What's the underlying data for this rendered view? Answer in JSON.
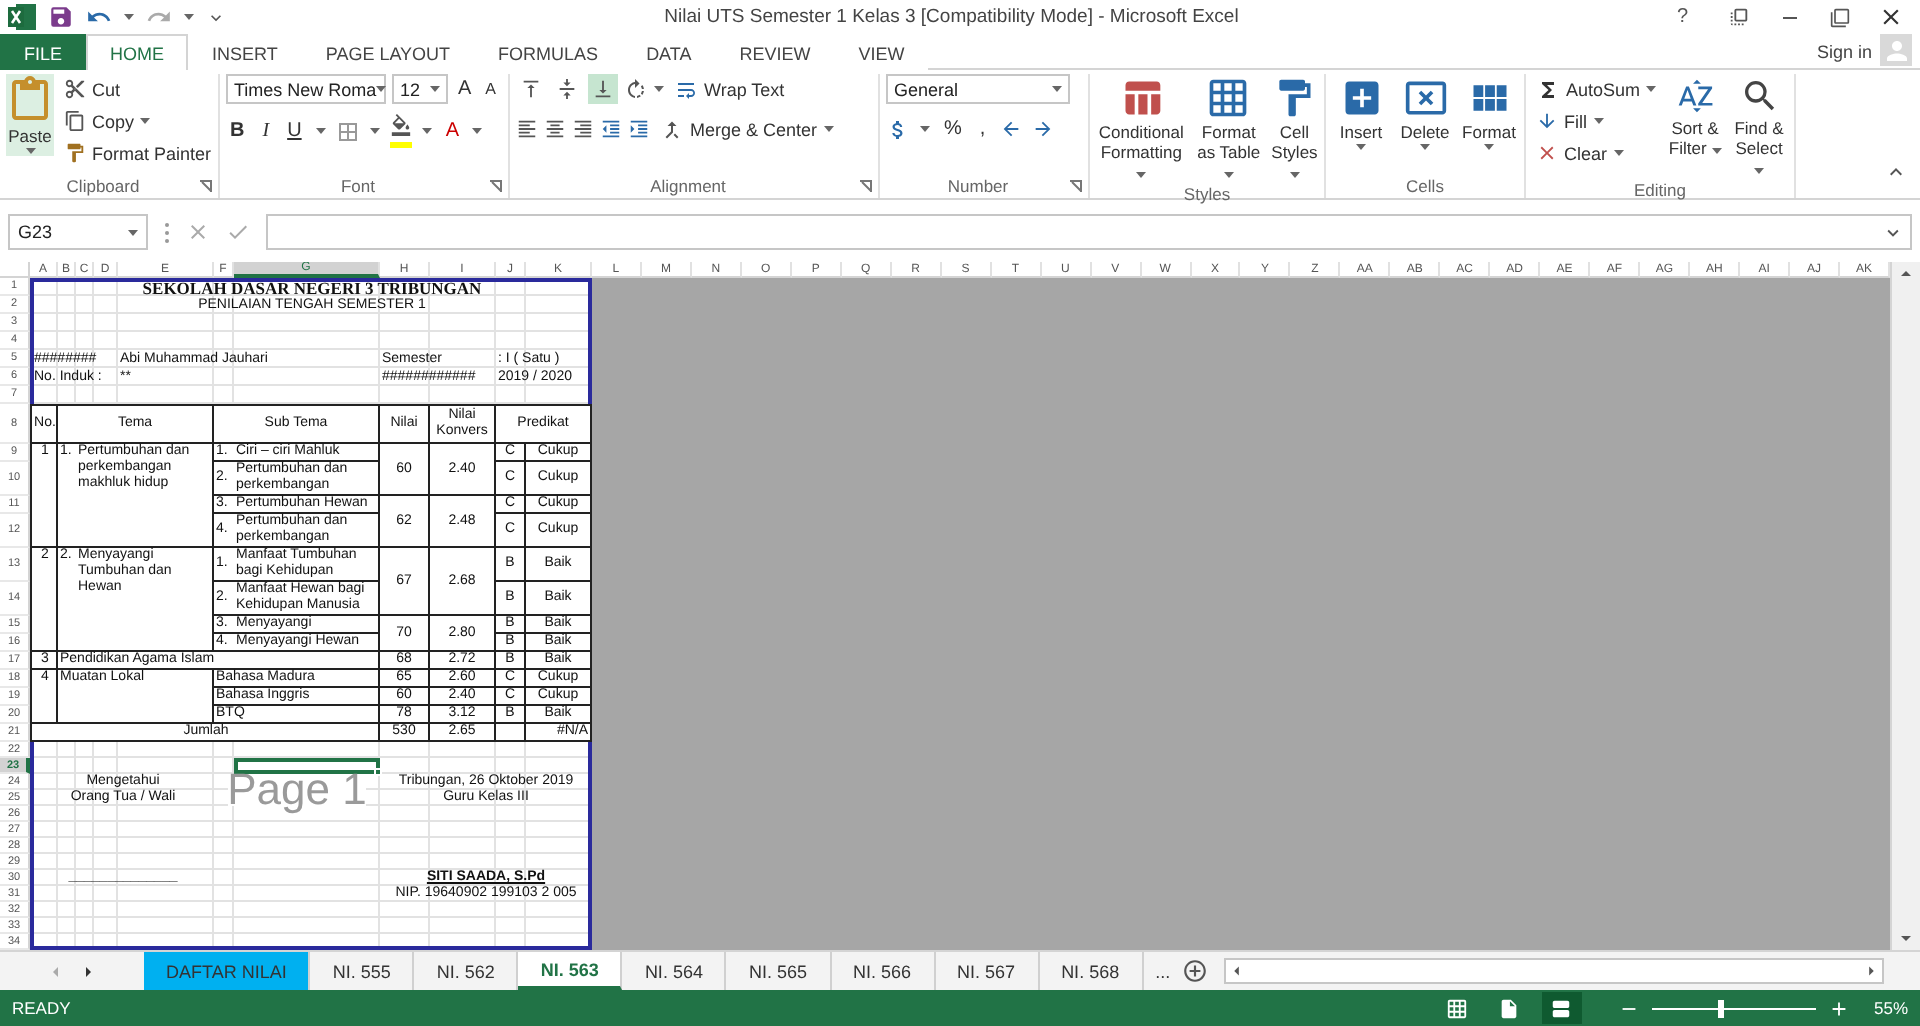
{
  "window": {
    "title": "Nilai UTS Semester 1 Kelas 3  [Compatibility Mode] - Microsoft Excel",
    "help": "?"
  },
  "ribbon_tabs": [
    {
      "label": "FILE",
      "kind": "file",
      "selected": false
    },
    {
      "label": "HOME",
      "kind": "tab",
      "selected": true
    },
    {
      "label": "INSERT",
      "kind": "tab",
      "selected": false
    },
    {
      "label": "PAGE LAYOUT",
      "kind": "tab",
      "selected": false
    },
    {
      "label": "FORMULAS",
      "kind": "tab",
      "selected": false
    },
    {
      "label": "DATA",
      "kind": "tab",
      "selected": false
    },
    {
      "label": "REVIEW",
      "kind": "tab",
      "selected": false
    },
    {
      "label": "VIEW",
      "kind": "tab",
      "selected": false
    }
  ],
  "account": {
    "label": "Sign in"
  },
  "ribbon": {
    "groups": [
      {
        "kind": "clipboard",
        "label": "Clipboard",
        "paste": "Paste",
        "cut": "Cut",
        "copy": "Copy",
        "format_painter": "Format Painter"
      },
      {
        "kind": "font",
        "label": "Font",
        "font_name": "Times New Roma",
        "font_size": "12",
        "grow": "A",
        "shrink": "A",
        "bold": "B",
        "italic": "I",
        "underline": "U",
        "font_color": "A"
      },
      {
        "kind": "alignment",
        "label": "Alignment",
        "vertical_align": [
          {
            "kind": "top",
            "selected": false
          },
          {
            "kind": "middle",
            "selected": false
          },
          {
            "kind": "bottom",
            "selected": true
          }
        ],
        "wrap_text": "Wrap Text",
        "merge": "Merge & Center"
      },
      {
        "kind": "number",
        "label": "Number",
        "format": "General",
        "percent": "%",
        "comma": ","
      },
      {
        "kind": "styles",
        "label": "Styles",
        "buttons": [
          {
            "kind": "conditional",
            "label": "Conditional Formatting"
          },
          {
            "kind": "table",
            "label": "Format as Table"
          },
          {
            "kind": "cell",
            "label": "Cell Styles"
          }
        ]
      },
      {
        "kind": "cells",
        "label": "Cells",
        "buttons": [
          {
            "kind": "insert",
            "label": "Insert"
          },
          {
            "kind": "delete",
            "label": "Delete"
          },
          {
            "kind": "format",
            "label": "Format"
          }
        ]
      },
      {
        "kind": "editing",
        "label": "Editing",
        "autosum": "AutoSum",
        "fill": "Fill",
        "clear": "Clear",
        "sort": "Sort & Filter",
        "find": "Find & Select"
      }
    ]
  },
  "formula_bar": {
    "name_box": "G23"
  },
  "sheet": {
    "columns": [
      {
        "label": "A",
        "selected": false
      },
      {
        "label": "B",
        "selected": false
      },
      {
        "label": "C",
        "selected": false
      },
      {
        "label": "D",
        "selected": false
      },
      {
        "label": "E",
        "selected": false
      },
      {
        "label": "F",
        "selected": false
      },
      {
        "label": "G",
        "selected": true
      },
      {
        "label": "H",
        "selected": false
      },
      {
        "label": "I",
        "selected": false
      },
      {
        "label": "J",
        "selected": false
      },
      {
        "label": "K",
        "selected": false
      },
      {
        "label": "L",
        "selected": false
      },
      {
        "label": "M",
        "selected": false
      },
      {
        "label": "N",
        "selected": false
      },
      {
        "label": "O",
        "selected": false
      },
      {
        "label": "P",
        "selected": false
      },
      {
        "label": "Q",
        "selected": false
      },
      {
        "label": "R",
        "selected": false
      },
      {
        "label": "S",
        "selected": false
      },
      {
        "label": "T",
        "selected": false
      },
      {
        "label": "U",
        "selected": false
      },
      {
        "label": "V",
        "selected": false
      },
      {
        "label": "W",
        "selected": false
      },
      {
        "label": "X",
        "selected": false
      },
      {
        "label": "Y",
        "selected": false
      },
      {
        "label": "Z",
        "selected": false
      },
      {
        "label": "AA",
        "selected": false
      },
      {
        "label": "AB",
        "selected": false
      },
      {
        "label": "AC",
        "selected": false
      },
      {
        "label": "AD",
        "selected": false
      },
      {
        "label": "AE",
        "selected": false
      },
      {
        "label": "AF",
        "selected": false
      },
      {
        "label": "AG",
        "selected": false
      },
      {
        "label": "AH",
        "selected": false
      },
      {
        "label": "AI",
        "selected": false
      },
      {
        "label": "AJ",
        "selected": false
      },
      {
        "label": "AK",
        "selected": false
      }
    ],
    "rows": [
      {
        "label": "1",
        "selected": false
      },
      {
        "label": "2",
        "selected": false
      },
      {
        "label": "3",
        "selected": false
      },
      {
        "label": "4",
        "selected": false
      },
      {
        "label": "5",
        "selected": false
      },
      {
        "label": "6",
        "selected": false
      },
      {
        "label": "7",
        "selected": false
      },
      {
        "label": "8",
        "selected": false
      },
      {
        "label": "9",
        "selected": false
      },
      {
        "label": "10",
        "selected": false
      },
      {
        "label": "11",
        "selected": false
      },
      {
        "label": "12",
        "selected": false
      },
      {
        "label": "13",
        "selected": false
      },
      {
        "label": "14",
        "selected": false
      },
      {
        "label": "15",
        "selected": false
      },
      {
        "label": "16",
        "selected": false
      },
      {
        "label": "17",
        "selected": false
      },
      {
        "label": "18",
        "selected": false
      },
      {
        "label": "19",
        "selected": false
      },
      {
        "label": "20",
        "selected": false
      },
      {
        "label": "21",
        "selected": false
      },
      {
        "label": "22",
        "selected": false
      },
      {
        "label": "23",
        "selected": true
      },
      {
        "label": "24",
        "selected": false
      },
      {
        "label": "25",
        "selected": false
      },
      {
        "label": "26",
        "selected": false
      },
      {
        "label": "27",
        "selected": false
      },
      {
        "label": "28",
        "selected": false
      },
      {
        "label": "29",
        "selected": false
      },
      {
        "label": "30",
        "selected": false
      },
      {
        "label": "31",
        "selected": false
      },
      {
        "label": "32",
        "selected": false
      },
      {
        "label": "33",
        "selected": false
      },
      {
        "label": "34",
        "selected": false
      }
    ],
    "cells": [
      {
        "text": "SEKOLAH DASAR NEGERI 3 TRIBUNGAN"
      },
      {
        "text": "PENILAIAN TENGAH SEMESTER 1"
      },
      {
        "text": "########"
      },
      {
        "text": "Abi Muhammad Jauhari"
      },
      {
        "text": "Semester"
      },
      {
        "text": ": I ( Satu )"
      },
      {
        "text": "No. Induk :"
      },
      {
        "text": "**"
      },
      {
        "text": "############"
      },
      {
        "text": "2019 / 2020"
      },
      {
        "text": "No."
      },
      {
        "text": "Tema"
      },
      {
        "text": "Sub Tema"
      },
      {
        "text": "Nilai"
      },
      {
        "text": "Nilai Konvers"
      },
      {
        "text": "Predikat"
      },
      {
        "text": "1"
      },
      {
        "text": "1."
      },
      {
        "text": "Pertumbuhan dan perkembangan makhluk hidup"
      },
      {
        "text": "1."
      },
      {
        "text": "Ciri – ciri Mahluk"
      },
      {
        "text": "60"
      },
      {
        "text": "2.40"
      },
      {
        "text": "C"
      },
      {
        "text": "Cukup"
      },
      {
        "text": "2."
      },
      {
        "text": "Pertumbuhan dan perkembangan"
      },
      {
        "text": "C"
      },
      {
        "text": "Cukup"
      },
      {
        "text": "3."
      },
      {
        "text": "Pertumbuhan Hewan"
      },
      {
        "text": "62"
      },
      {
        "text": "2.48"
      },
      {
        "text": "C"
      },
      {
        "text": "Cukup"
      },
      {
        "text": "4."
      },
      {
        "text": "Pertumbuhan dan perkembangan"
      },
      {
        "text": "C"
      },
      {
        "text": "Cukup"
      },
      {
        "text": "2"
      },
      {
        "text": "2."
      },
      {
        "text": "Menyayangi Tumbuhan dan Hewan"
      },
      {
        "text": "1."
      },
      {
        "text": "Manfaat Tumbuhan bagi Kehidupan"
      },
      {
        "text": "67"
      },
      {
        "text": "2.68"
      },
      {
        "text": "B"
      },
      {
        "text": "Baik"
      },
      {
        "text": "2."
      },
      {
        "text": "Manfaat Hewan bagi Kehidupan Manusia"
      },
      {
        "text": "B"
      },
      {
        "text": "Baik"
      },
      {
        "text": "3."
      },
      {
        "text": "Menyayangi"
      },
      {
        "text": "70"
      },
      {
        "text": "2.80"
      },
      {
        "text": "B"
      },
      {
        "text": "Baik"
      },
      {
        "text": "4."
      },
      {
        "text": "Menyayangi Hewan"
      },
      {
        "text": "B"
      },
      {
        "text": "Baik"
      },
      {
        "text": "3"
      },
      {
        "text": "Pendidikan Agama Islam"
      },
      {
        "text": "68"
      },
      {
        "text": "2.72"
      },
      {
        "text": "B"
      },
      {
        "text": "Baik"
      },
      {
        "text": "4"
      },
      {
        "text": "Muatan Lokal"
      },
      {
        "text": "Bahasa Madura"
      },
      {
        "text": "65"
      },
      {
        "text": "2.60"
      },
      {
        "text": "C"
      },
      {
        "text": "Cukup"
      },
      {
        "text": "Bahasa Inggris"
      },
      {
        "text": "60"
      },
      {
        "text": "2.40"
      },
      {
        "text": "C"
      },
      {
        "text": "Cukup"
      },
      {
        "text": "BTQ"
      },
      {
        "text": "78"
      },
      {
        "text": "3.12"
      },
      {
        "text": "B"
      },
      {
        "text": "Baik"
      },
      {
        "text": "Jumlah"
      },
      {
        "text": "530"
      },
      {
        "text": "2.65"
      },
      {
        "text": "#N/A"
      },
      {
        "text": "Mengetahui"
      },
      {
        "text": "Tribungan, 26 Oktober 2019"
      },
      {
        "text": "Orang Tua / Wali"
      },
      {
        "text": "Guru Kelas III"
      },
      {
        "text": "______________"
      },
      {
        "text": "SITI SAADA, S.Pd"
      },
      {
        "text": "NIP. 19640902 199103 2 005"
      }
    ],
    "page_label": "Page 1"
  },
  "sheet_tabs": [
    {
      "label": "DAFTAR NILAI",
      "selected": false,
      "color": "#00b0f0"
    },
    {
      "label": "NI. 555",
      "selected": false
    },
    {
      "label": "NI. 562",
      "selected": false
    },
    {
      "label": "NI. 563",
      "selected": true
    },
    {
      "label": "NI. 564",
      "selected": false
    },
    {
      "label": "NI. 565",
      "selected": false
    },
    {
      "label": "NI. 566",
      "selected": false
    },
    {
      "label": "NI. 567",
      "selected": false
    },
    {
      "label": "NI. 568",
      "selected": false
    }
  ],
  "more_tabs": "...",
  "status_bar": {
    "status": "READY",
    "views": [
      {
        "kind": "normal",
        "selected": false
      },
      {
        "kind": "page_layout",
        "selected": false
      },
      {
        "kind": "page_break",
        "selected": true
      }
    ],
    "zoom": {
      "level": 0.4,
      "reading": "55%"
    }
  }
}
